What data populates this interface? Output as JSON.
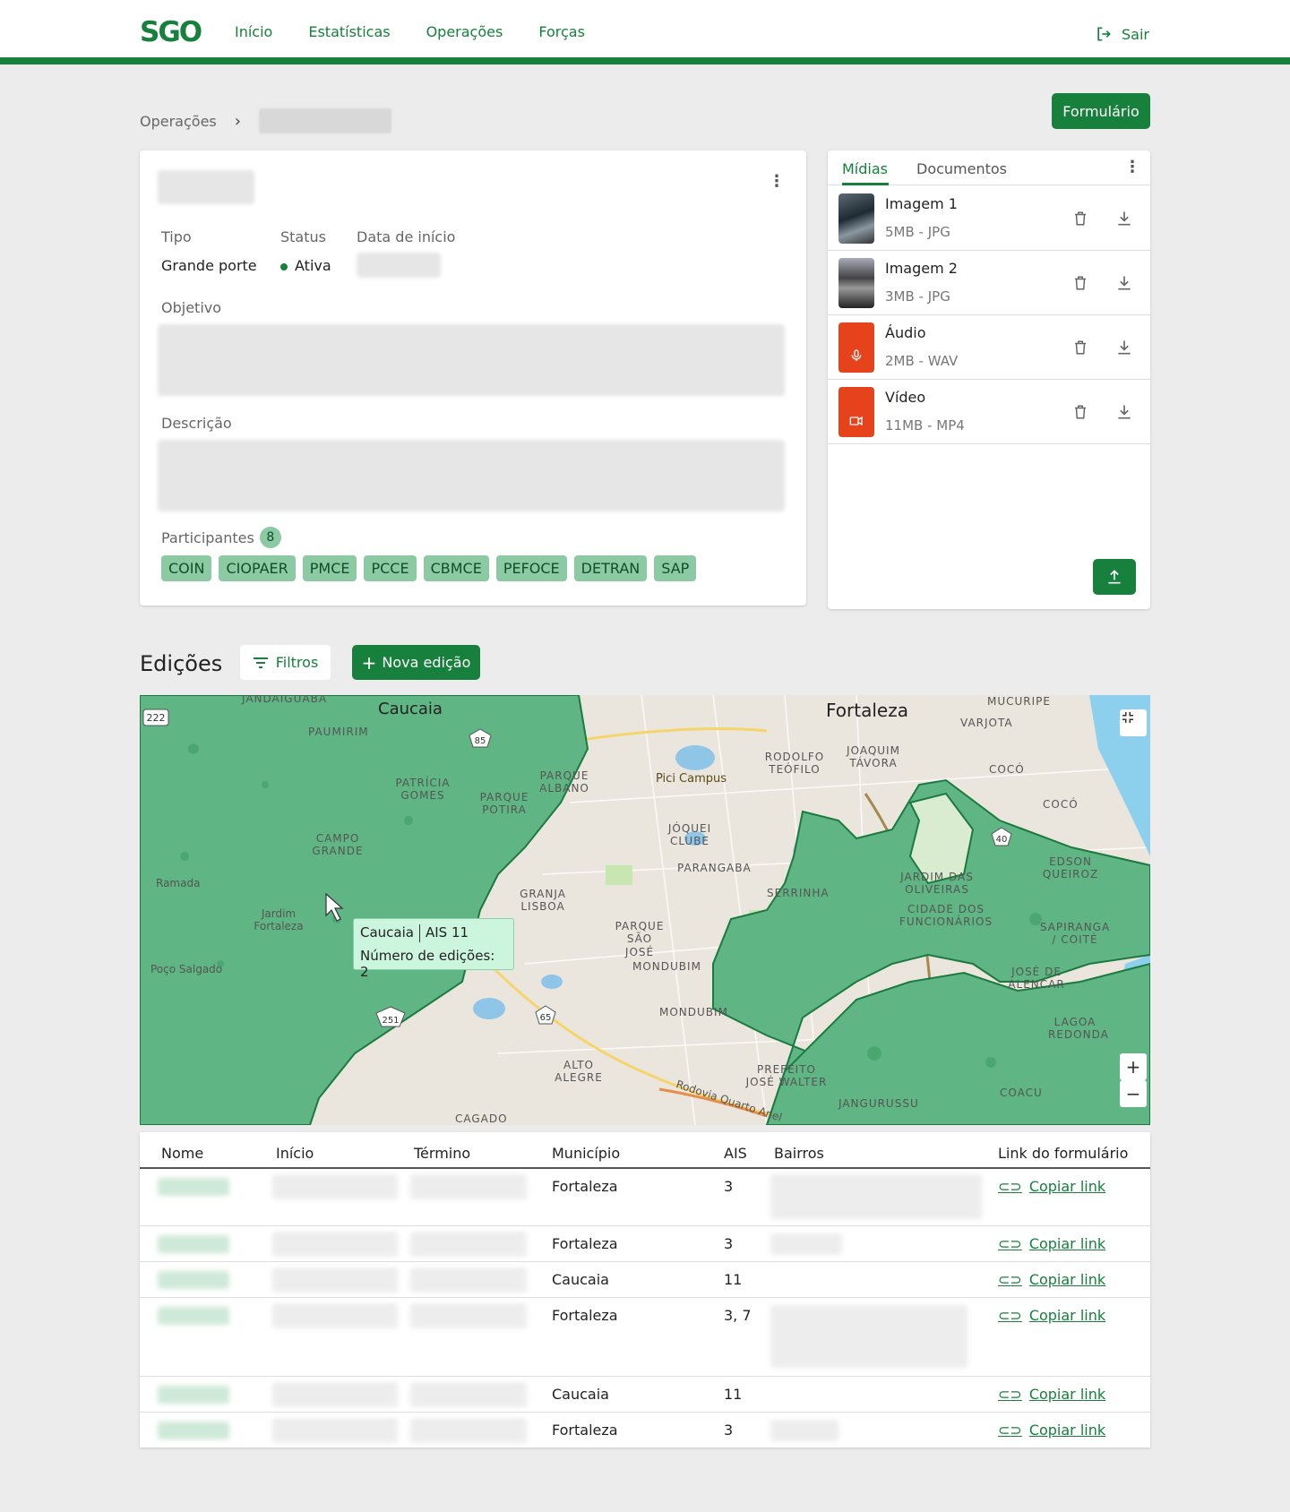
{
  "header": {
    "logo": "SGO",
    "nav": [
      "Início",
      "Estatísticas",
      "Operações",
      "Forças"
    ],
    "logout": "Sair"
  },
  "breadcrumb": {
    "root": "Operações"
  },
  "form_button": "Formulário",
  "info": {
    "labels": {
      "tipo": "Tipo",
      "status": "Status",
      "data_inicio": "Data de início",
      "objetivo": "Objetivo",
      "descricao": "Descrição",
      "participantes": "Participantes"
    },
    "tipo": "Grande porte",
    "status": "Ativa",
    "participantes_count": "8",
    "participantes": [
      "COIN",
      "CIOPAER",
      "PMCE",
      "PCCE",
      "CBMCE",
      "PEFOCE",
      "DETRAN",
      "SAP"
    ]
  },
  "media": {
    "tabs": [
      "Mídias",
      "Documentos"
    ],
    "items": [
      {
        "name": "Imagem 1",
        "meta": "5MB - JPG"
      },
      {
        "name": "Imagem 2",
        "meta": "3MB - JPG"
      },
      {
        "name": "Áudio",
        "meta": "2MB - WAV"
      },
      {
        "name": "Vídeo",
        "meta": "11MB - MP4"
      }
    ]
  },
  "edicoes": {
    "title": "Edições",
    "filters_label": "Filtros",
    "new_label": "Nova edição"
  },
  "map": {
    "cities": [
      "Caucaia",
      "Fortaleza"
    ],
    "places": [
      "JANDAIGUABA",
      "PAUMIRIM",
      "PATRÍCIA GOMES",
      "PARQUE POTIRA",
      "PARQUE ALBANO",
      "CAMPO GRANDE",
      "Ramada",
      "Jardim Fortaleza",
      "Poço Salgado",
      "GRANJA LISBOA",
      "PARQUE SÃO JOSÉ",
      "MONDUBIM",
      "ALTO ALEGRE",
      "CAGADO",
      "Pici Campus",
      "JÓQUEI CLUBE",
      "PARANGABA",
      "SERRINHA",
      "RODOLFO TEÓFILO",
      "JOAQUIM TÁVORA",
      "VARJOTA",
      "MUCURIPE",
      "COCÓ",
      "EDSON QUEIROZ",
      "JARDIM DAS OLIVEIRAS",
      "CIDADE DOS FUNCIONÁRIOS",
      "SAPIRANGA / COITÉ",
      "JOSÉ DE ALENCAR",
      "LAGOA REDONDA",
      "PREFEITO JOSÉ WALTER",
      "JANGURUSSU",
      "COACU",
      "Rodovia Quarto Anel"
    ],
    "road_badges": [
      "222",
      "85",
      "251",
      "65",
      "40"
    ],
    "tooltip": {
      "city": "Caucaia",
      "ais": "AIS 11",
      "count": "Número de edições: 2"
    }
  },
  "table": {
    "headers": [
      "Nome",
      "Início",
      "Término",
      "Município",
      "AIS",
      "Bairros",
      "Link do formulário"
    ],
    "link_label": "Copiar link",
    "rows": [
      {
        "municipio": "Fortaleza",
        "ais": "3"
      },
      {
        "municipio": "Fortaleza",
        "ais": "3"
      },
      {
        "municipio": "Caucaia",
        "ais": "11"
      },
      {
        "municipio": "Fortaleza",
        "ais": "3, 7"
      },
      {
        "municipio": "Caucaia",
        "ais": "11"
      },
      {
        "municipio": "Fortaleza",
        "ais": "3"
      }
    ]
  },
  "colors": {
    "primary": "#16803c",
    "chip": "#8ccaa3",
    "map_area": "#5fb583",
    "tooltip": "#ccf5dd"
  }
}
